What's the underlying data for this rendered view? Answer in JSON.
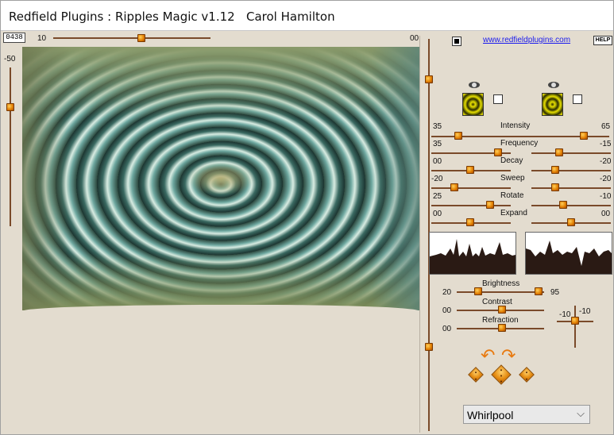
{
  "window": {
    "title": "Redfield Plugins : Ripples Magic v1.12   Carol Hamilton"
  },
  "left_panel": {
    "seed_value": "0438",
    "top_slider": {
      "min_label": "10",
      "max_label": "00",
      "value_fraction": 0.5
    },
    "left_slider": {
      "label": "-50",
      "value_fraction": 0.2
    }
  },
  "right_panel": {
    "link_text": "www.redfieldplugins.com",
    "help_label": "HELP",
    "eye_left_icon": "eye-icon",
    "eye_right_icon": "eye-icon",
    "params": [
      {
        "name": "Intensity",
        "left": "35",
        "right": "65"
      },
      {
        "name": "Frequency",
        "left": "35",
        "right": "-15"
      },
      {
        "name": "Decay",
        "left": "00",
        "right": "-20"
      },
      {
        "name": "Sweep",
        "left": "-20",
        "right": "-20"
      },
      {
        "name": "Rotate",
        "left": "25",
        "right": "-10"
      },
      {
        "name": "Expand",
        "left": "00",
        "right": "00"
      }
    ],
    "brightness": {
      "label": "Brightness",
      "left": "20",
      "right": "95"
    },
    "contrast": {
      "label": "Contrast",
      "left": "00"
    },
    "refraction": {
      "label": "Refraction",
      "left": "00"
    },
    "crosshair": {
      "x_label": "-10",
      "y_label": "-10"
    },
    "preset_select": {
      "value": "Whirlpool"
    }
  },
  "colors": {
    "thumb": "#e07c00",
    "track": "#7a4a2a",
    "link": "#1a1aee",
    "panel": "#e3dccf"
  }
}
